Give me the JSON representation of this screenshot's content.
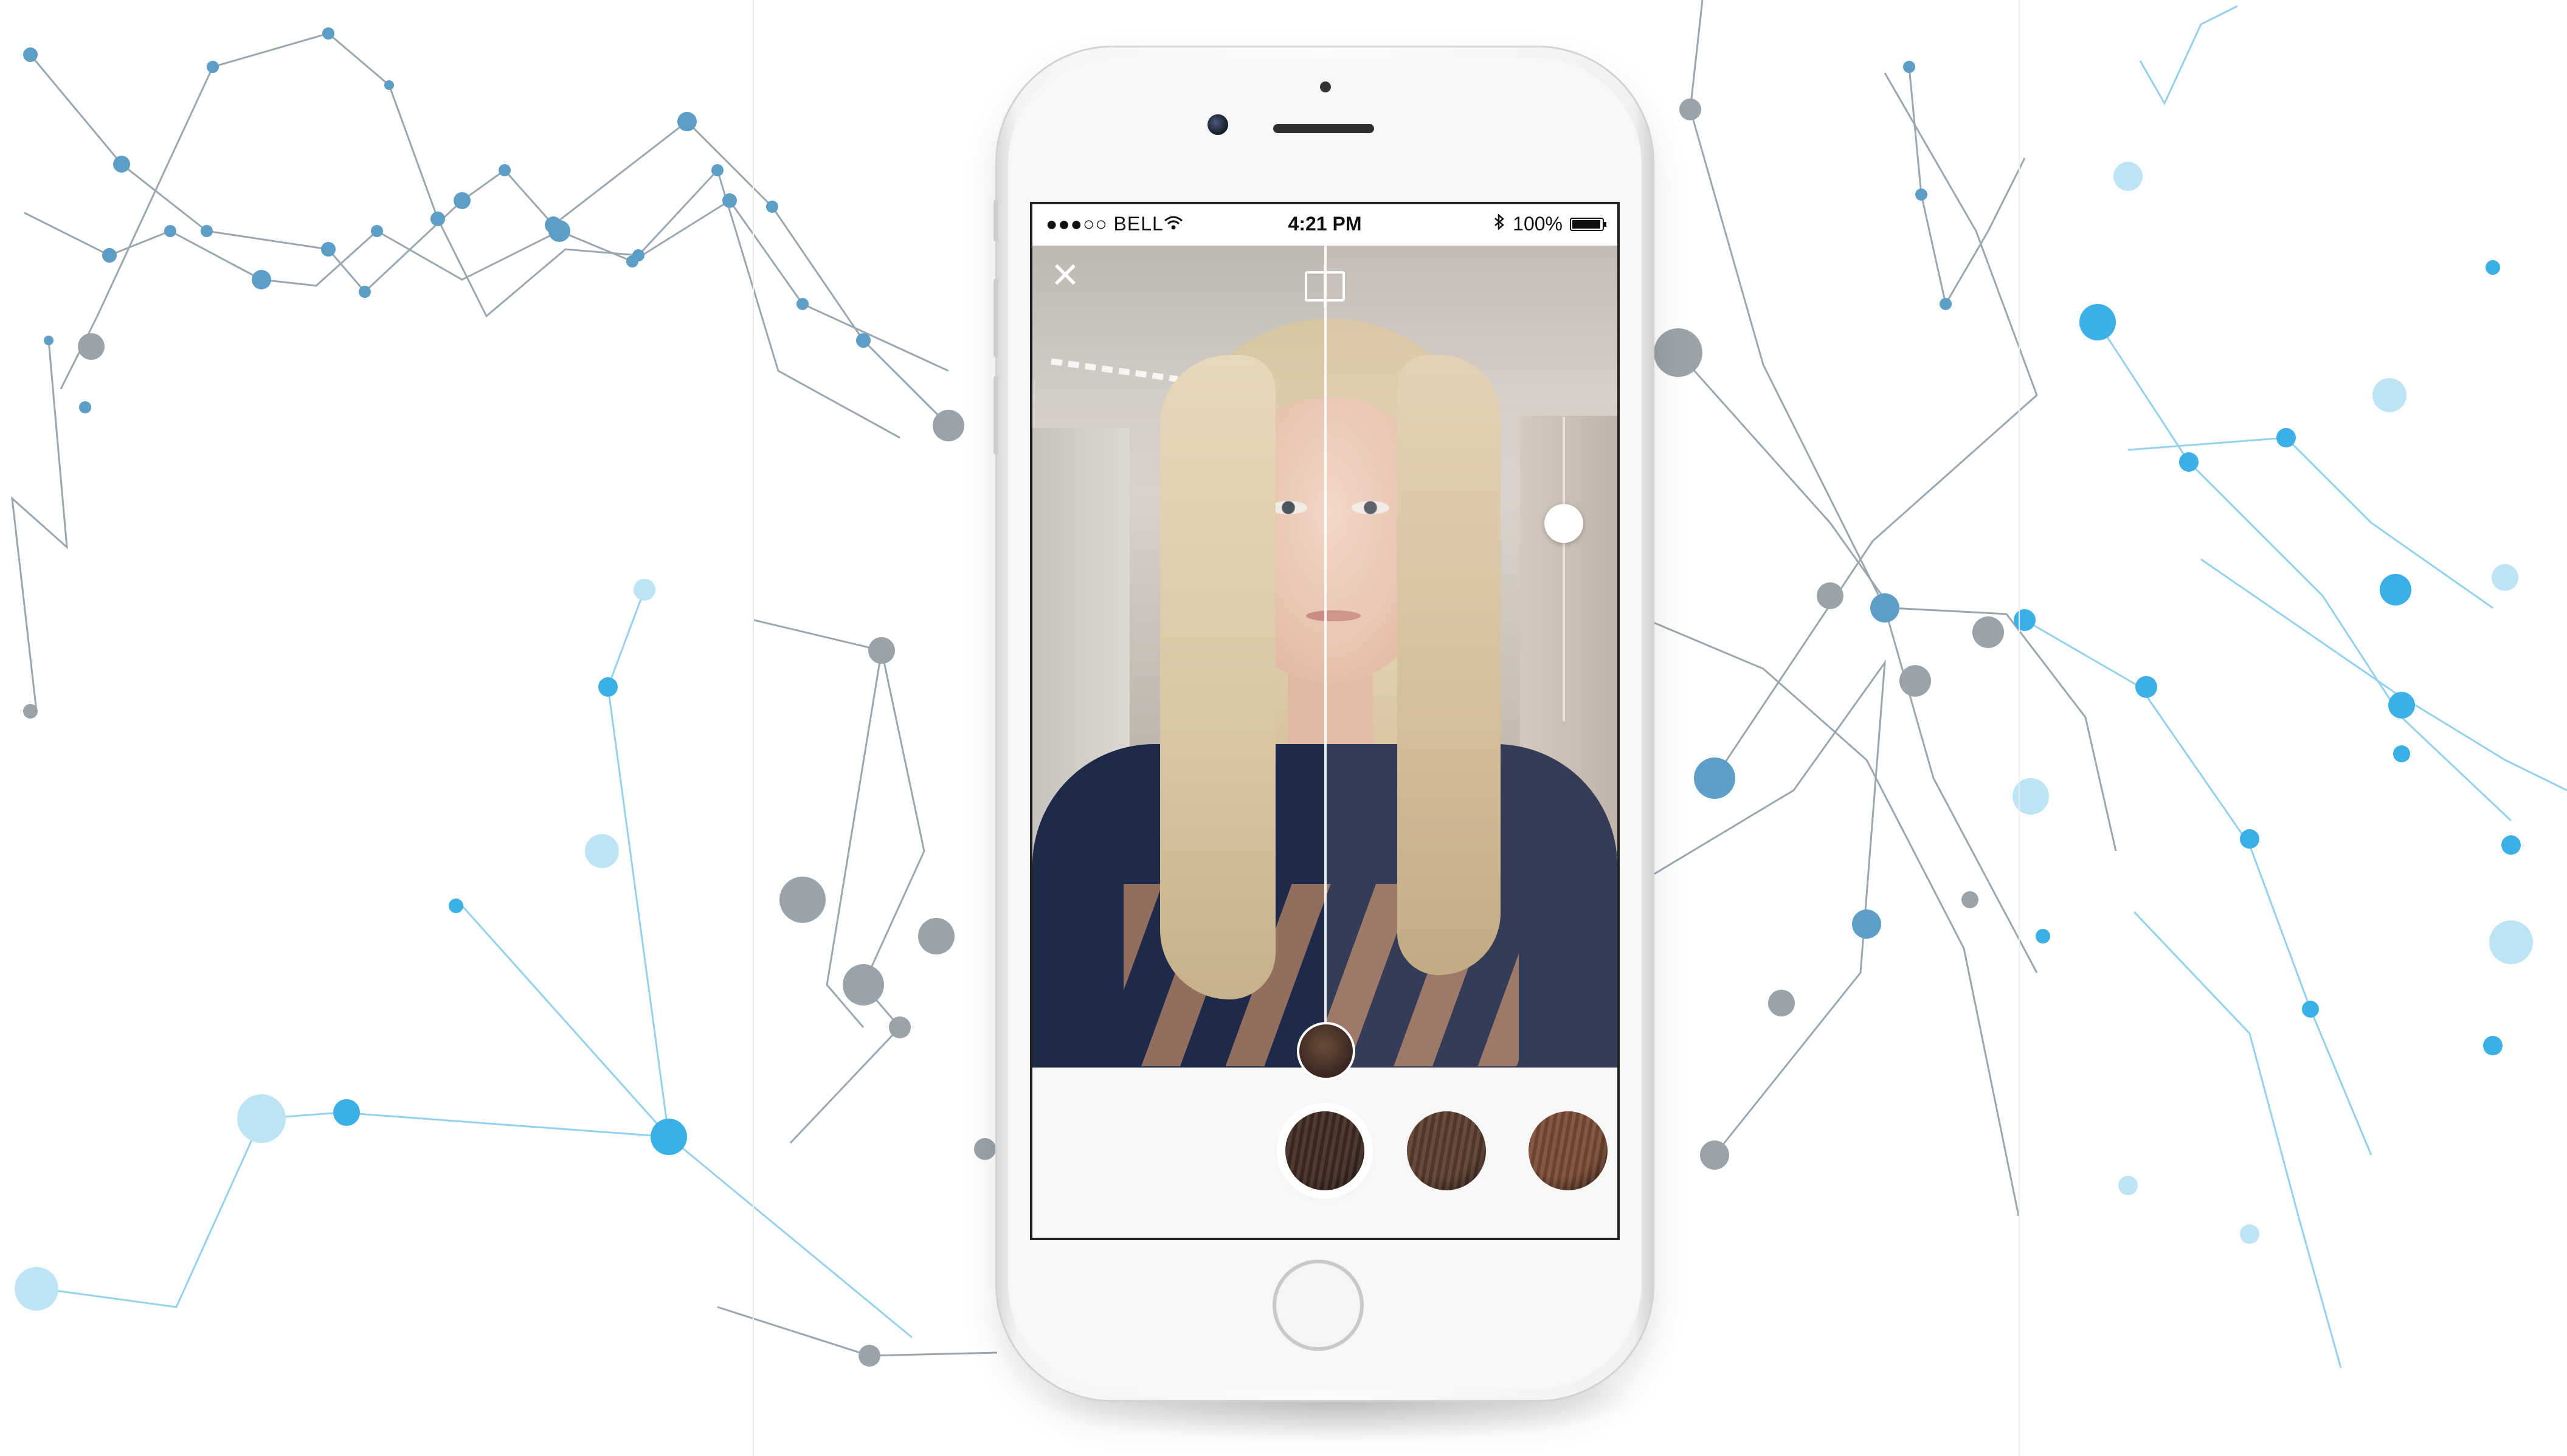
{
  "status_bar": {
    "carrier": "●●●○○ BELL",
    "wifi_icon": "wifi-icon",
    "time": "4:21 PM",
    "bluetooth_icon": "bluetooth-icon",
    "battery": "100%"
  },
  "camera_view": {
    "close_icon": "×",
    "compare_icon": "compare-split-icon",
    "intensity_slider": {
      "value": 0.35
    }
  },
  "swatches": [
    {
      "name": "dark-brown",
      "color": "#3f2b22",
      "selected": true
    },
    {
      "name": "medium-brown",
      "color": "#5a3d2e",
      "selected": false
    },
    {
      "name": "chestnut",
      "color": "#7a4a34",
      "selected": false
    }
  ],
  "colors": {
    "network_gray": "#9aa3aa",
    "network_blue": "#3bb0e6",
    "background": "#ffffff"
  }
}
